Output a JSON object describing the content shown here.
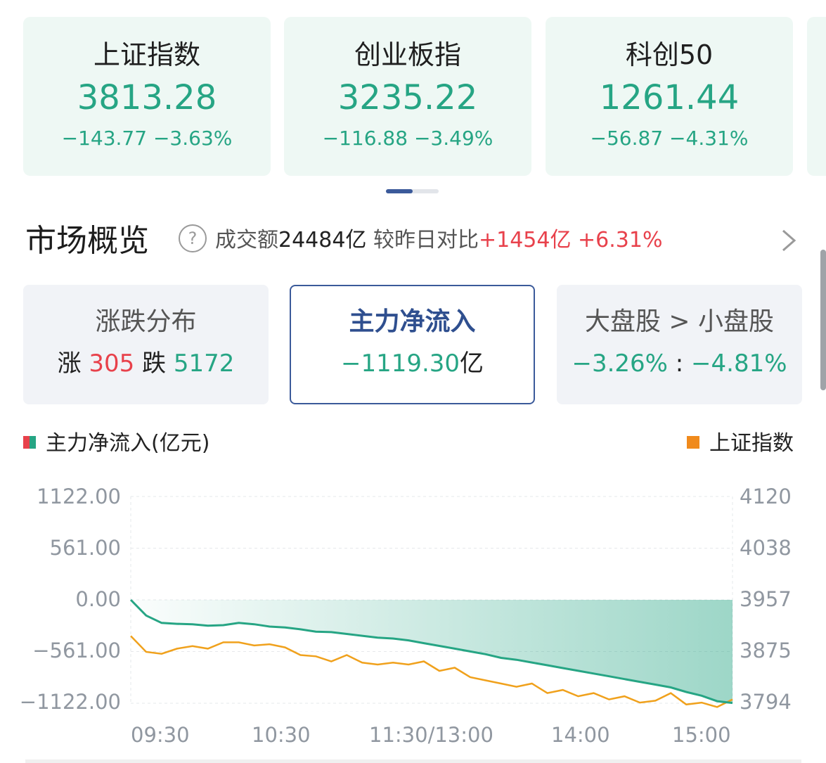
{
  "index_cards": [
    {
      "name": "上证指数",
      "value": "3813.28",
      "change": "−143.77  −3.63%"
    },
    {
      "name": "创业板指",
      "value": "3235.22",
      "change": "−116.88  −3.49%"
    },
    {
      "name": "科创50",
      "value": "1261.44",
      "change": "−56.87  −4.31%"
    }
  ],
  "overview": {
    "title": "市场概览",
    "help_icon": "question-icon",
    "turnover_label": "成交额",
    "turnover_value": "24484亿",
    "compare_label": " 较昨日对比",
    "compare_amount": "+1454亿",
    "compare_percent": "+6.31%",
    "chevron": "chevron-right-icon"
  },
  "stats": {
    "distribution": {
      "title": "涨跌分布",
      "up_label": "涨 ",
      "up_value": "305",
      "down_label": " 跌 ",
      "down_value": "5172"
    },
    "mainflow": {
      "title": "主力净流入",
      "value": "−1119.30",
      "unit": "亿"
    },
    "caps": {
      "title": "大盘股 > 小盘股",
      "large": "−3.26%",
      "sep": " : ",
      "small": "−4.81%"
    }
  },
  "colors": {
    "up": "#e8414b",
    "down": "#26a584",
    "index_line": "#f0a11c",
    "accent": "#3b5a9a"
  },
  "chart_data": {
    "type": "line",
    "series": [
      {
        "name": "主力净流入(亿元)",
        "axis": "left",
        "values": [
          0,
          -170,
          -250,
          -260,
          -265,
          -280,
          -275,
          -250,
          -265,
          -290,
          -300,
          -320,
          -345,
          -350,
          -370,
          -390,
          -410,
          -420,
          -440,
          -470,
          -500,
          -530,
          -560,
          -590,
          -630,
          -650,
          -680,
          -710,
          -740,
          -770,
          -800,
          -830,
          -860,
          -890,
          -920,
          -950,
          -1000,
          -1040,
          -1100,
          -1119
        ]
      },
      {
        "name": "上证指数",
        "axis": "right",
        "values": [
          3900,
          3875,
          3872,
          3880,
          3884,
          3880,
          3890,
          3890,
          3885,
          3887,
          3882,
          3870,
          3868,
          3860,
          3870,
          3858,
          3855,
          3858,
          3855,
          3860,
          3845,
          3850,
          3835,
          3830,
          3825,
          3820,
          3825,
          3810,
          3815,
          3805,
          3810,
          3800,
          3805,
          3795,
          3798,
          3810,
          3792,
          3795,
          3788,
          3800
        ]
      }
    ],
    "x_ticks": [
      "09:30",
      "10:30",
      "11:30/13:00",
      "14:00",
      "15:00"
    ],
    "y_left_ticks": [
      "1122.00",
      "561.00",
      "0.00",
      "−561.00",
      "−1122.00"
    ],
    "y_right_ticks": [
      "4120",
      "4038",
      "3957",
      "3875",
      "3794"
    ],
    "ylim_left": [
      -1122,
      1122
    ],
    "ylim_right": [
      3794,
      4120
    ],
    "legend_left": "主力净流入(亿元)",
    "legend_right": "上证指数",
    "grid": true
  }
}
